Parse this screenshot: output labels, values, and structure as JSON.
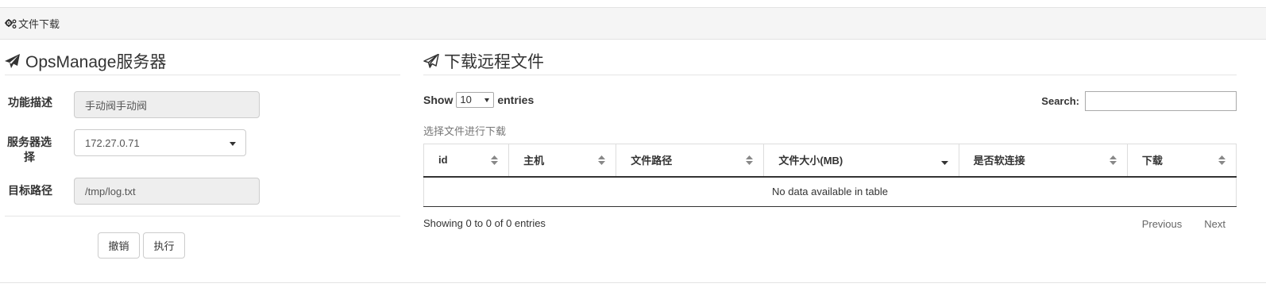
{
  "breadcrumb": {
    "icon": "gears-icon",
    "label": "文件下载"
  },
  "left_panel": {
    "title": "OpsManage服务器",
    "fields": [
      {
        "label": "功能描述",
        "value": "手动阀手动阀"
      },
      {
        "label": "服务器选择",
        "value": "172.27.0.71"
      },
      {
        "label": "目标路径",
        "value": "/tmp/log.txt"
      }
    ],
    "buttons": {
      "cancel": "撤销",
      "execute": "执行"
    }
  },
  "right_panel": {
    "title": "下载远程文件",
    "length_menu": {
      "prefix": "Show",
      "selected": "10",
      "suffix": "entries"
    },
    "search_label": "Search:",
    "caption": "选择文件进行下载",
    "table": {
      "columns": [
        "id",
        "主机",
        "文件路径",
        "文件大小(MB)",
        "是否软连接",
        "下载"
      ],
      "empty_message": "No data available in table"
    },
    "info": "Showing 0 to 0 of 0 entries",
    "pager": {
      "previous": "Previous",
      "next": "Next"
    }
  },
  "colors": {
    "header_bg": "#f5f5f5",
    "readonly_bg": "#eeeeee",
    "text": "#333333"
  }
}
